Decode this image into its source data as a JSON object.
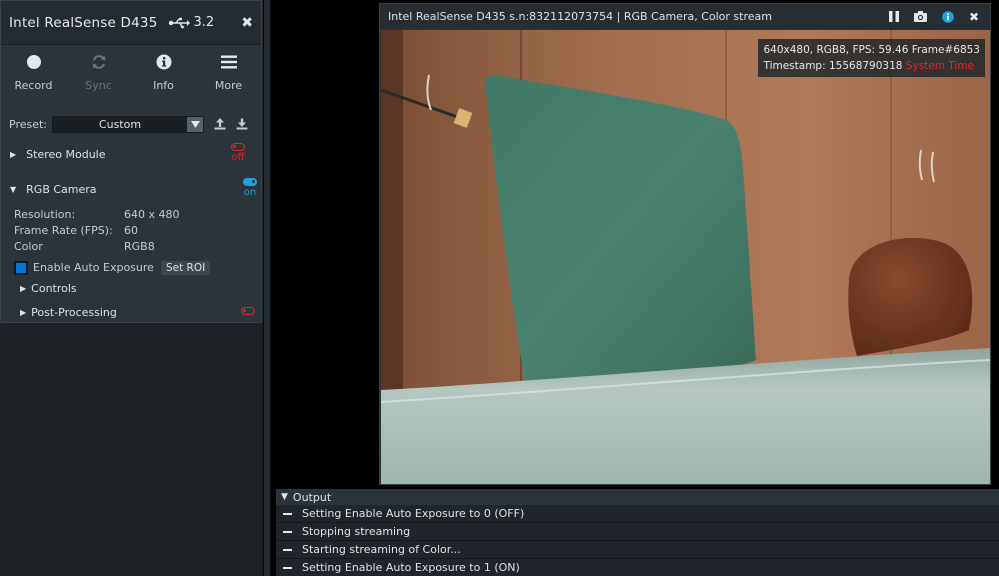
{
  "device": {
    "name": "Intel RealSense D435",
    "usb_version": "3.2"
  },
  "toolbar": {
    "record": "Record",
    "sync": "Sync",
    "info": "Info",
    "more": "More"
  },
  "preset": {
    "label": "Preset:",
    "value": "Custom"
  },
  "modules": {
    "stereo": {
      "label": "Stereo Module",
      "state": "off"
    },
    "rgb": {
      "label": "RGB Camera",
      "state": "on"
    }
  },
  "rgb_props": {
    "resolution_label": "Resolution:",
    "resolution_value": "640 x 480",
    "fps_label": "Frame Rate (FPS):",
    "fps_value": "60",
    "color_label": "Color",
    "color_value": "RGB8",
    "auto_exposure_label": "Enable Auto Exposure",
    "set_roi": "Set ROI",
    "controls": "Controls",
    "post_processing": "Post-Processing"
  },
  "stream": {
    "title": "Intel RealSense D435 s.n:832112073754 | RGB Camera, Color stream",
    "overlay_line1": "640x480, RGB8, FPS:  59.46  Frame#6853",
    "timestamp": "Timestamp: 15568790318",
    "system_time": "System Time"
  },
  "output": {
    "title": "Output",
    "lines": [
      "Setting Enable Auto Exposure to 0 (OFF)",
      "Stopping streaming",
      "Starting streaming of Color...",
      "Setting Enable Auto Exposure to 1 (ON)"
    ]
  },
  "colors": {
    "off": "#e0262a",
    "on": "#1ca2e0",
    "accent_blue": "#0078d4"
  }
}
